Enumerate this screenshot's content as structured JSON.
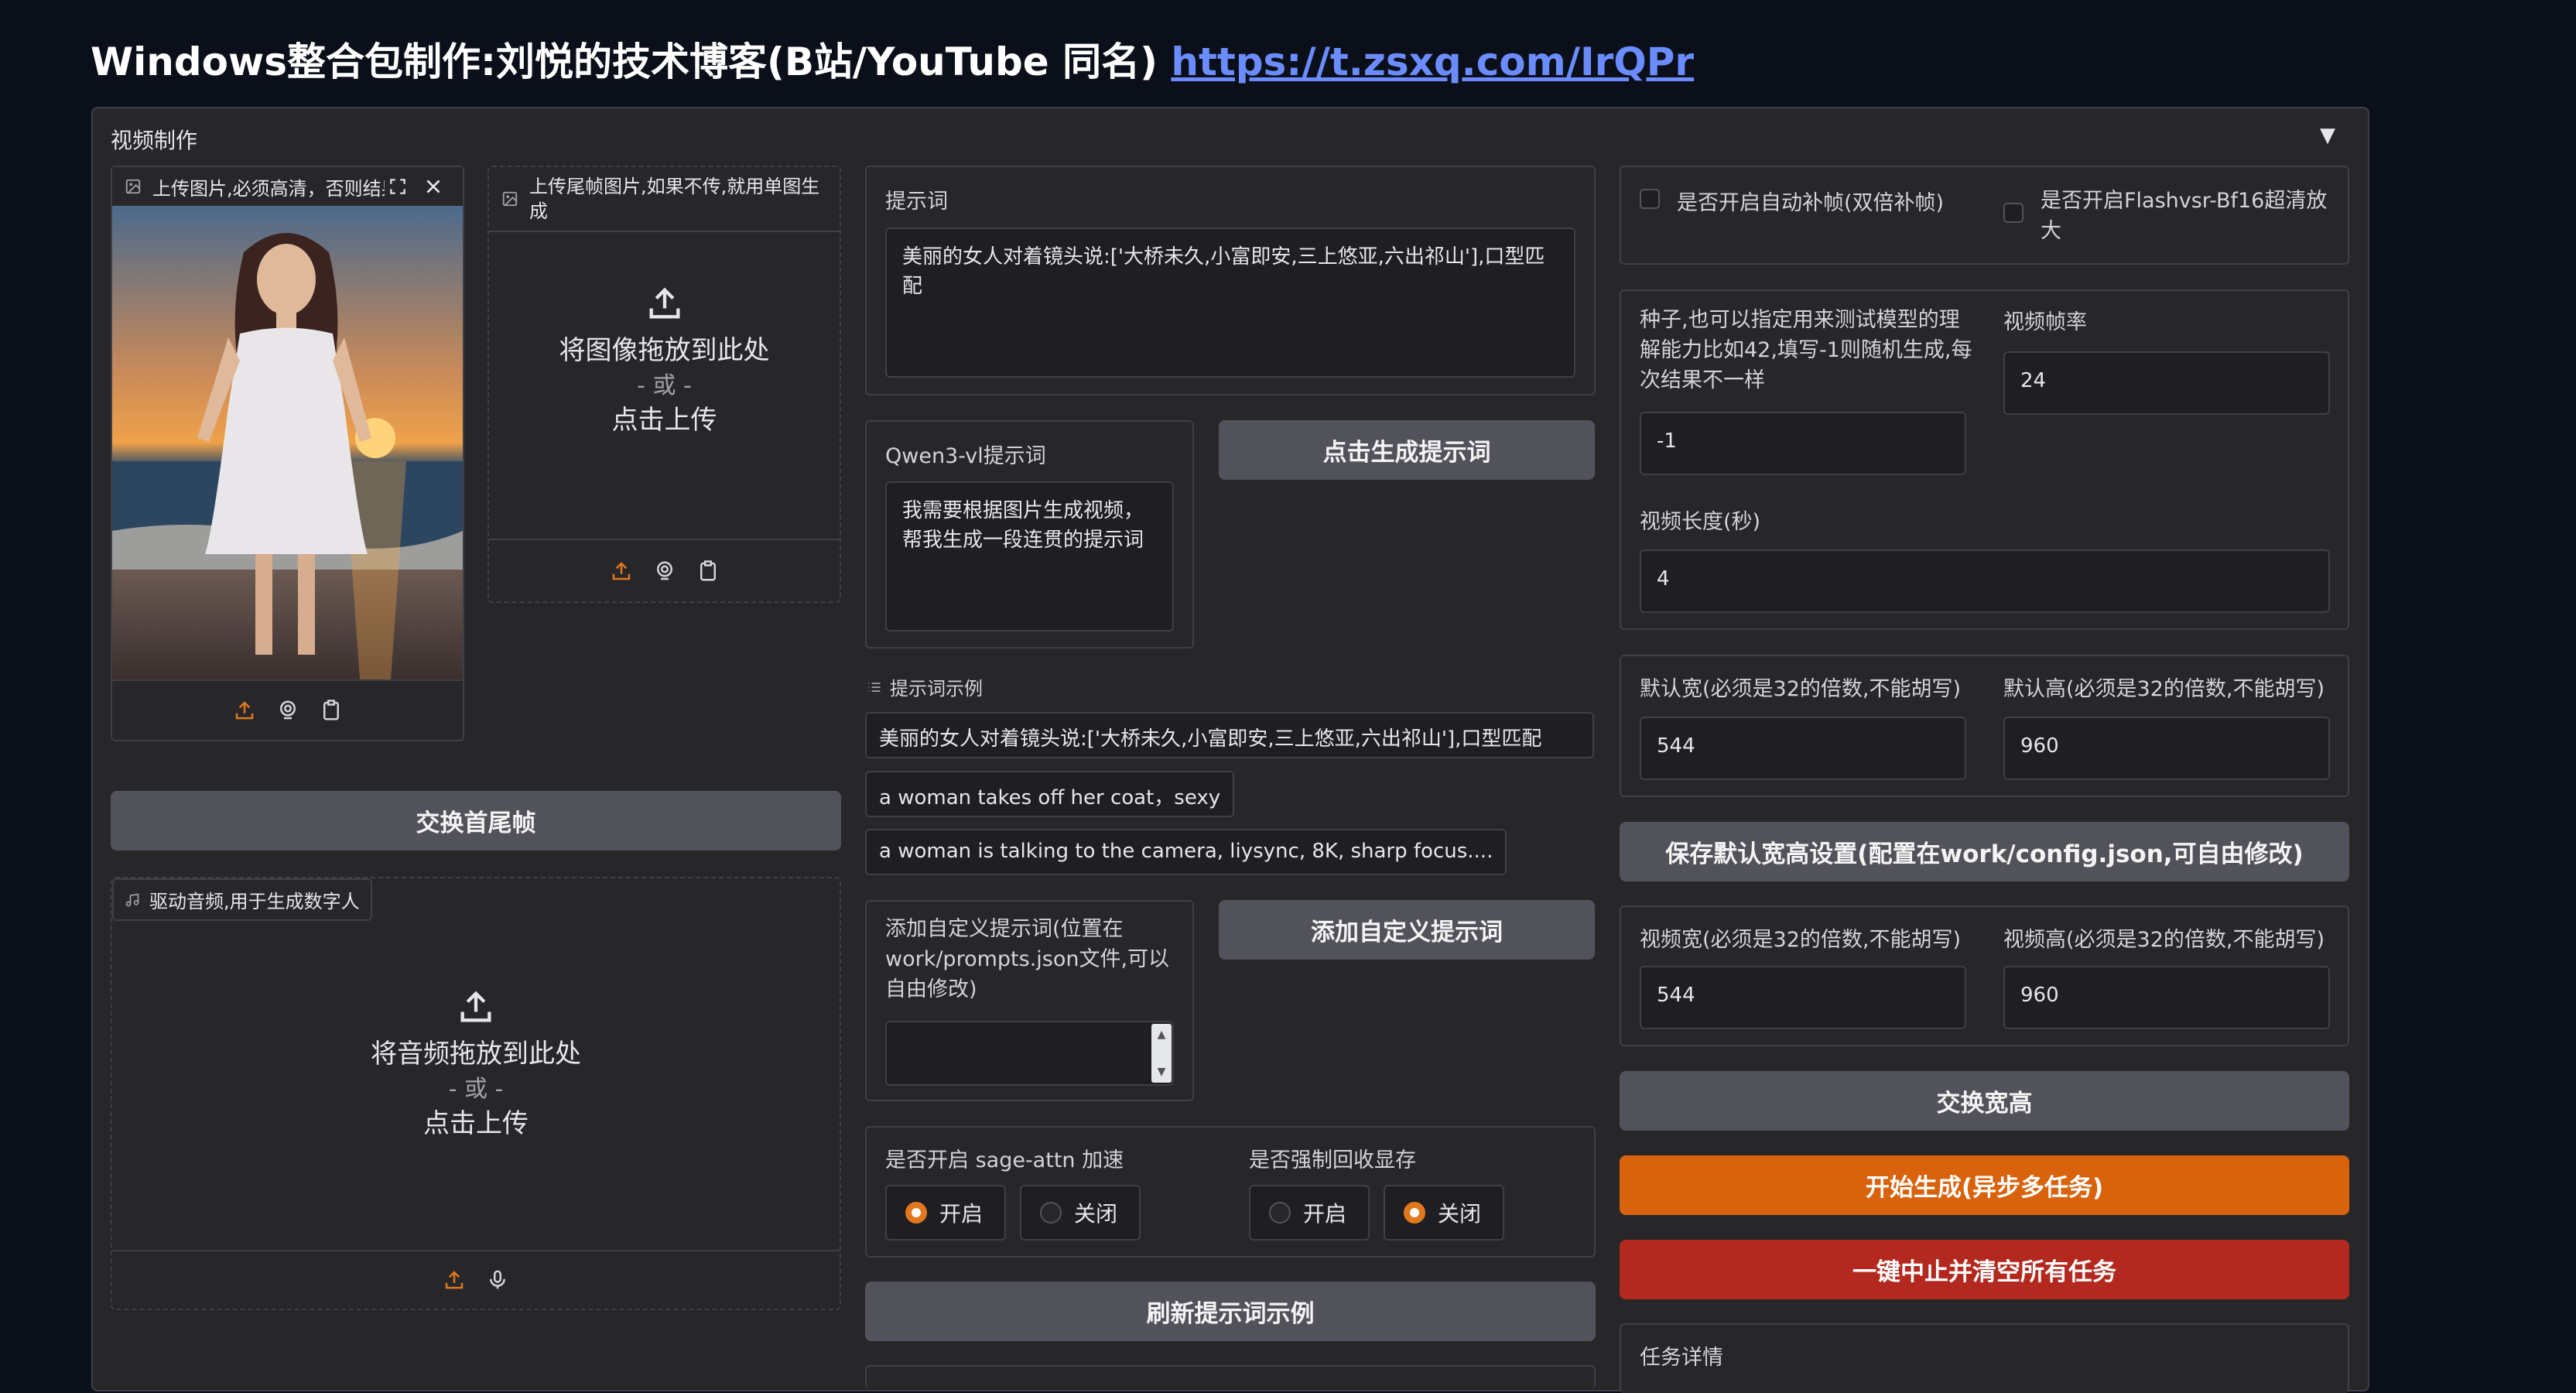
{
  "header": {
    "title": "Windows整合包制作:刘悦的技术博客(B站/YouTube 同名)",
    "link": "https://t.zsxq.com/IrQPr"
  },
  "panel": {
    "title": "视频制作",
    "collapse_icon": "▼"
  },
  "upload_image": {
    "label": "上传图片,必须高清，否则结果",
    "icons": [
      "image-icon",
      "fullscreen-icon",
      "close-icon",
      "upload-icon",
      "webcam-icon",
      "clipboard-icon"
    ]
  },
  "upload_last_frame": {
    "label": "上传尾帧图片,如果不传,就用单图生成",
    "drop_main": "将图像拖放到此处",
    "drop_or": "- 或 -",
    "drop_click": "点击上传"
  },
  "swap_frames_button": "交换首尾帧",
  "audio_upload": {
    "label": "驱动音频,用于生成数字人",
    "drop_main": "将音频拖放到此处",
    "drop_or": "- 或 -",
    "drop_click": "点击上传"
  },
  "prompt": {
    "label": "提示词",
    "value": "美丽的女人对着镜头说:['大桥未久,小富即安,三上悠亚,六出祁山'],口型匹配"
  },
  "qwen_prompt": {
    "label": "Qwen3-vl提示词",
    "value": "我需要根据图片生成视频，帮我生成一段连贯的提示词"
  },
  "generate_prompt_button": "点击生成提示词",
  "examples": {
    "label": "提示词示例",
    "items": [
      "美丽的女人对着镜头说:['大桥未久,小富即安,三上悠亚,六出祁山'],口型匹配",
      "a woman takes off her coat，sexy",
      "a woman is talking to the camera, liysync, 8K, sharp focus...."
    ]
  },
  "custom_prompt": {
    "label": "添加自定义提示词(位置在work/prompts.json文件,可以自由修改)",
    "value": ""
  },
  "add_custom_prompt_button": "添加自定义提示词",
  "sage_attn": {
    "label": "是否开启 sage-attn 加速",
    "options": [
      "开启",
      "关闭"
    ],
    "selected": "开启"
  },
  "force_gc": {
    "label": "是否强制回收显存",
    "options": [
      "开启",
      "关闭"
    ],
    "selected": "关闭"
  },
  "refresh_examples_button": "刷新提示词示例",
  "checks": {
    "interp": "是否开启自动补帧(双倍补帧)",
    "flashvsr": "是否开启Flashvsr-Bf16超清放大"
  },
  "seed": {
    "label": "种子,也可以指定用来测试模型的理解能力比如42,填写-1则随机生成,每次结果不一样",
    "value": "-1"
  },
  "fps": {
    "label": "视频帧率",
    "value": "24"
  },
  "duration": {
    "label": "视频长度(秒)",
    "value": "4"
  },
  "default_width": {
    "label": "默认宽(必须是32的倍数,不能胡写)",
    "value": "544"
  },
  "default_height": {
    "label": "默认高(必须是32的倍数,不能胡写)",
    "value": "960"
  },
  "save_defaults_button": "保存默认宽高设置(配置在work/config.json,可自由修改)",
  "video_width": {
    "label": "视频宽(必须是32的倍数,不能胡写)",
    "value": "544"
  },
  "video_height": {
    "label": "视频高(必须是32的倍数,不能胡写)",
    "value": "960"
  },
  "swap_wh_button": "交换宽高",
  "start_button": "开始生成(异步多任务)",
  "stop_button": "一键中止并清空所有任务",
  "task_details": {
    "label": "任务详情"
  },
  "colors": {
    "accent": "#d9620c",
    "danger": "#b3291f",
    "link": "#6a8cff",
    "background": "#0b0f19",
    "panel": "#27272a"
  }
}
